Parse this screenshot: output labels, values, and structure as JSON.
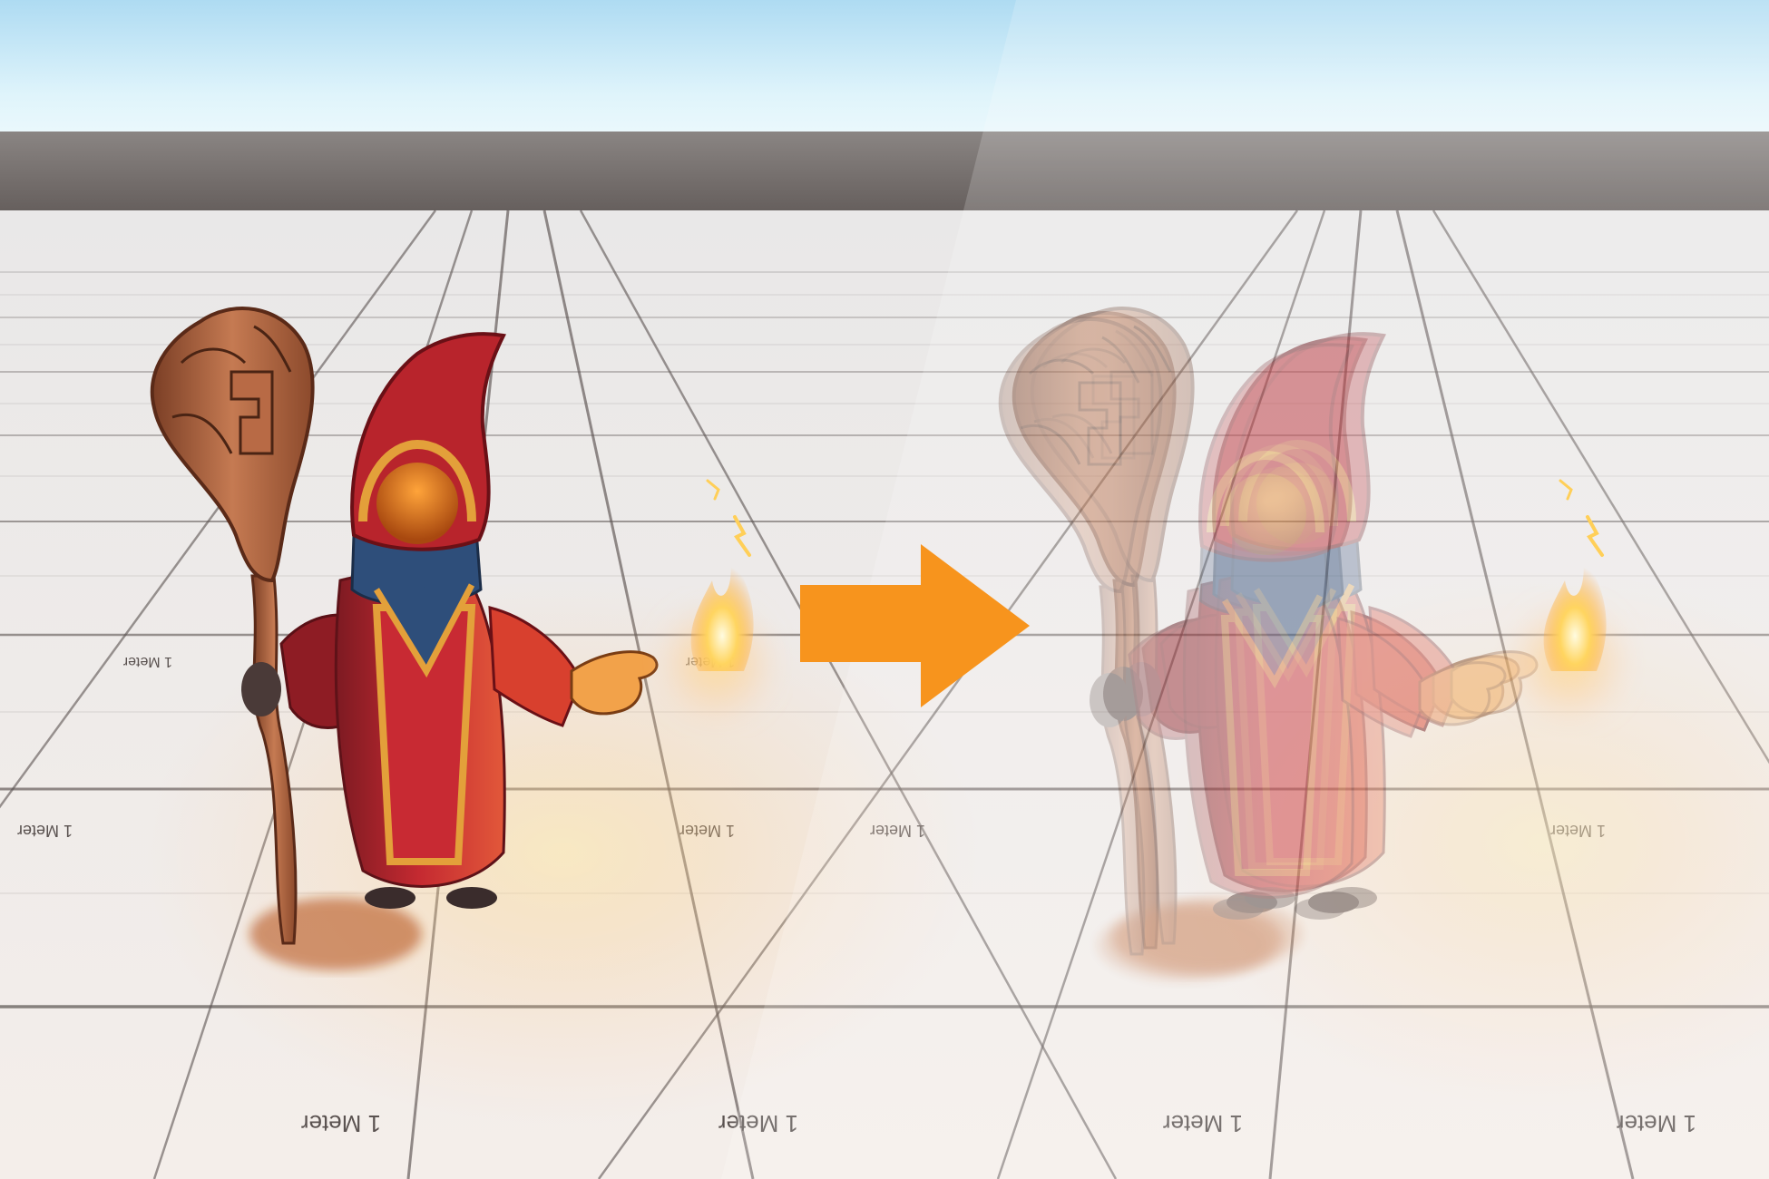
{
  "scene": {
    "grid_label": "1 Meter",
    "left_panel": "opaque-render",
    "right_panel": "transparent-render"
  },
  "colors": {
    "sky_top": "#b8dff3",
    "sky_bottom": "#f4fbfd",
    "horizon": "#6f6865",
    "floor": "#eeeceb",
    "grid_line": "#4a4342",
    "arrow": "#f7941d",
    "robe": "#b8242c",
    "trim": "#e3a03a",
    "staff": "#b06845",
    "scarf": "#2e4e7a",
    "fire": "#ffd36b"
  },
  "icons": [
    "right-arrow-icon",
    "fire-icon"
  ]
}
